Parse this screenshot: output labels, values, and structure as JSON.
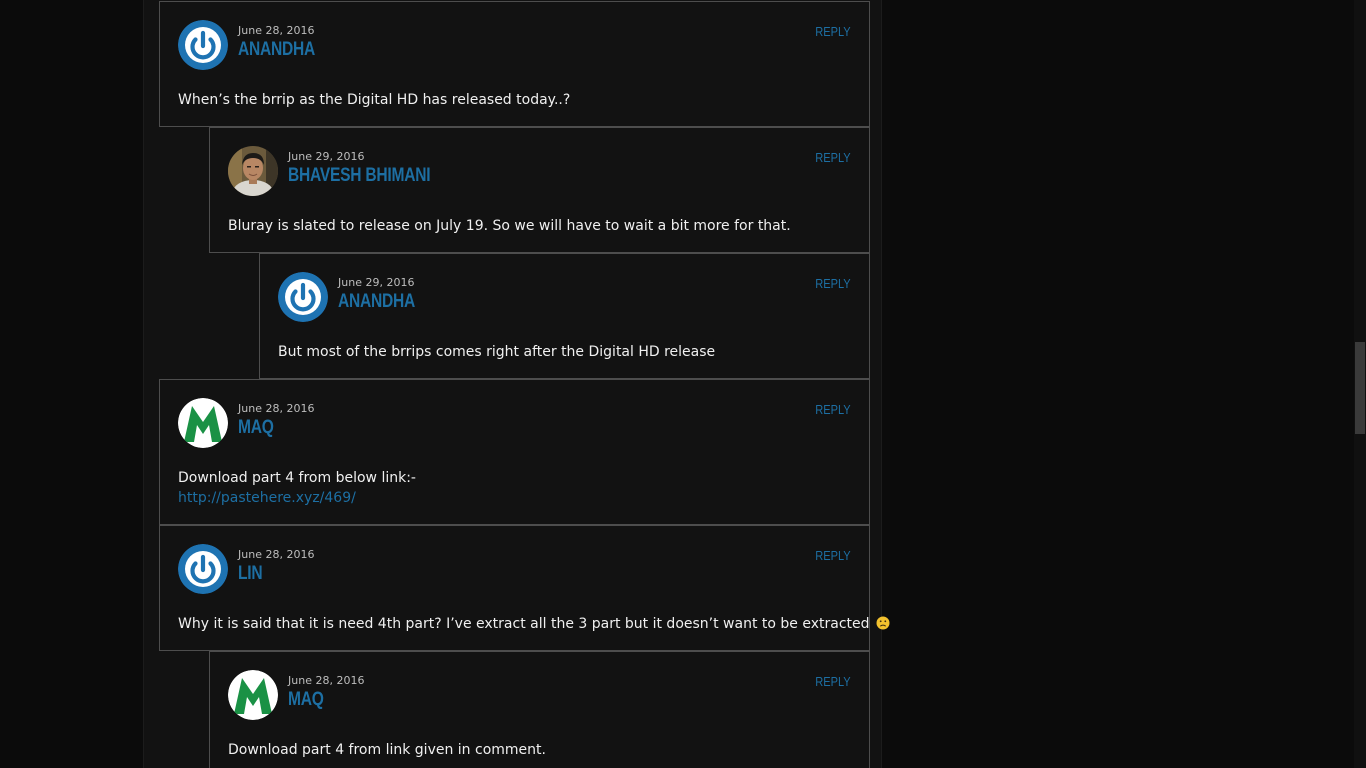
{
  "comments": [
    {
      "date": "June 28, 2016",
      "author": "ANANDHA",
      "reply_label": "REPLY",
      "avatar_icon": "power-icon",
      "text": "When’s the brrip as the Digital HD has released today..?"
    },
    {
      "date": "June 29, 2016",
      "author": "BHAVESH BHIMANI",
      "reply_label": "REPLY",
      "avatar_icon": "user-photo",
      "text": "Bluray is slated to release on July 19. So we will have to wait a bit more for that."
    },
    {
      "date": "June 29, 2016",
      "author": "ANANDHA",
      "reply_label": "REPLY",
      "avatar_icon": "power-icon",
      "text": "But most of the brrips comes right after the Digital HD release"
    },
    {
      "date": "June 28, 2016",
      "author": "MAQ",
      "reply_label": "REPLY",
      "avatar_icon": "m-logo-icon",
      "text": "Download part 4 from below link:-",
      "link": "http://pastehere.xyz/469/"
    },
    {
      "date": "June 28, 2016",
      "author": "LIN",
      "reply_label": "REPLY",
      "avatar_icon": "power-icon",
      "text": "Why it is said that it is need 4th part? I’ve extract all the 3 part but it doesn’t want to be extracted",
      "emoji": "sad-face-icon"
    },
    {
      "date": "June 28, 2016",
      "author": "MAQ",
      "reply_label": "REPLY",
      "avatar_icon": "m-logo-icon",
      "text": "Download part 4 from link given in comment."
    }
  ],
  "colors": {
    "accent": "#1d6fa3",
    "background": "#121212",
    "border": "#4d4d4d",
    "text": "#f0f0f0",
    "date": "#bdbdbd"
  }
}
